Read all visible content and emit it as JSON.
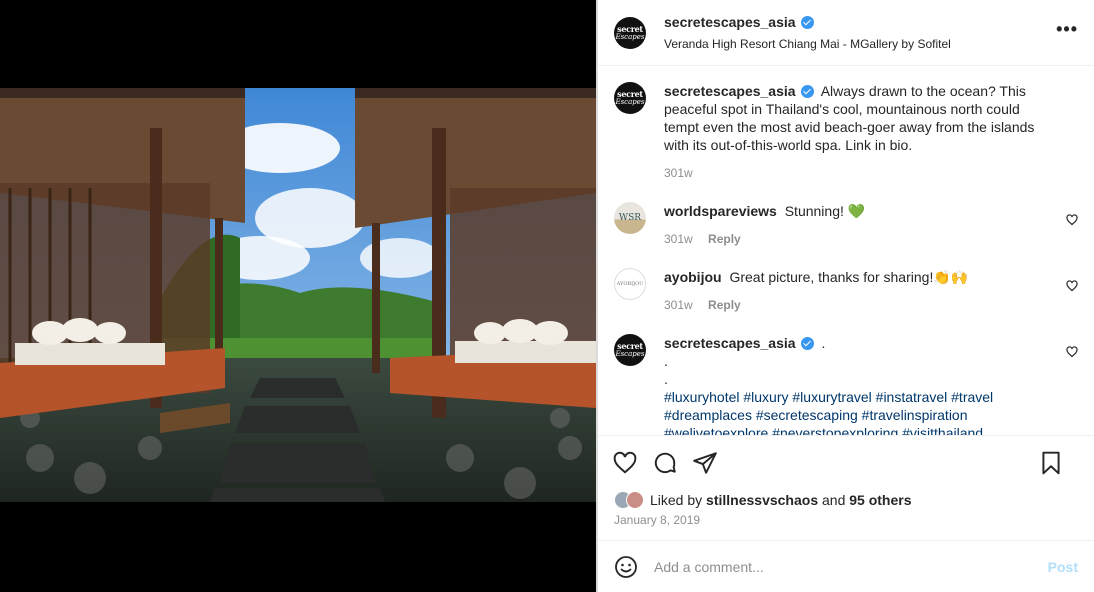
{
  "post": {
    "username": "secretescapes_asia",
    "location": "Veranda High Resort Chiang Mai - MGallery by Sofitel",
    "avatar_text": [
      "secret",
      "Escapes"
    ],
    "more_icon": "more-horizontal-icon"
  },
  "caption": {
    "username": "secretescapes_asia",
    "text": "Always drawn to the ocean? This peaceful spot in Thailand's cool, mountainous north could tempt even the most avid beach-goer away from the islands with its out-of-this-world spa. Link in bio.",
    "time": "301w"
  },
  "comments": [
    {
      "username": "worldspareviews",
      "text": "Stunning! 💚",
      "time": "301w",
      "reply": "Reply",
      "avatar_text": "WSR"
    },
    {
      "username": "ayobijou",
      "text": "Great picture, thanks for sharing!👏🙌",
      "time": "301w",
      "reply": "Reply",
      "avatar_text": "AYOBIJOU"
    },
    {
      "username": "secretescapes_asia",
      "text": ".",
      "lines": [
        ".",
        ".",
        "#luxuryhotel #luxury #luxurytravel #instatravel #travel",
        "#dreamplaces #secretescaping #travelinspiration",
        "#welivetoexplore #neverstopexploring #visitthailand"
      ]
    }
  ],
  "likes": {
    "prefix": "Liked by",
    "user": "stillnessvschaos",
    "and": "and",
    "others": "95 others"
  },
  "date": "January 8, 2019",
  "add_comment": {
    "placeholder": "Add a comment...",
    "post_label": "Post"
  },
  "colors": {
    "verified": "#3897f0",
    "hashtag": "#00376b",
    "post_disabled": "#b2dffc",
    "muted": "#8e8e8e"
  }
}
